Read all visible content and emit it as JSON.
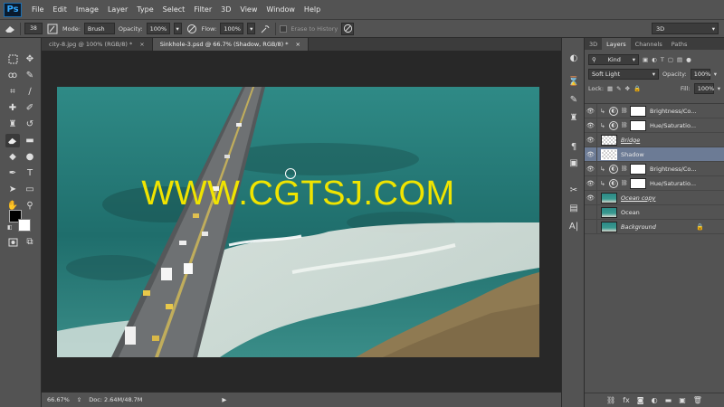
{
  "app": {
    "logo": "Ps"
  },
  "menu": [
    "File",
    "Edit",
    "Image",
    "Layer",
    "Type",
    "Select",
    "Filter",
    "3D",
    "View",
    "Window",
    "Help"
  ],
  "options": {
    "brush_size": "38",
    "mode_label": "Mode:",
    "mode_value": "Brush",
    "opacity_label": "Opacity:",
    "opacity_value": "100%",
    "flow_label": "Flow:",
    "flow_value": "100%",
    "erase_history_label": "Erase to History",
    "workspace": "3D"
  },
  "doc_tabs": [
    {
      "label": "city-8.jpg @ 100% (RGB/8) *",
      "close": "×"
    },
    {
      "label": "Sinkhole-3.psd @ 66.7% (Shadow, RGB/8) *",
      "close": "×"
    }
  ],
  "canvas": {
    "watermark": "WWW.CGTSJ.COM"
  },
  "status": {
    "zoom": "66.67%",
    "doc_size": "Doc: 2.64M/48.7M"
  },
  "panel_tabs": [
    "3D",
    "Layers",
    "Channels",
    "Paths"
  ],
  "layers_panel": {
    "filter_kind": "Kind",
    "blend_mode": "Soft Light",
    "opacity_label": "Opacity:",
    "opacity_value": "100%",
    "lock_label": "Lock:",
    "fill_label": "Fill:",
    "fill_value": "100%"
  },
  "layers": [
    {
      "name": "Brightness/Co...",
      "type": "adjustment",
      "visible": true,
      "selected": false
    },
    {
      "name": "Hue/Saturatio...",
      "type": "adjustment",
      "visible": true,
      "selected": false
    },
    {
      "name": "Bridge",
      "type": "pixel-transparent",
      "visible": true,
      "selected": false
    },
    {
      "name": "Shadow",
      "type": "pixel-transparent",
      "visible": true,
      "selected": true
    },
    {
      "name": "Brightness/Co...",
      "type": "adjustment",
      "visible": true,
      "selected": false
    },
    {
      "name": "Hue/Saturatio...",
      "type": "adjustment",
      "visible": true,
      "selected": false
    },
    {
      "name": "Ocean copy",
      "type": "pixel-ocean",
      "visible": true,
      "selected": false
    },
    {
      "name": "Ocean",
      "type": "pixel-ocean",
      "visible": false,
      "selected": false
    },
    {
      "name": "Background",
      "type": "pixel-ocean",
      "visible": false,
      "selected": false,
      "locked": true
    }
  ],
  "colors": {
    "selected_layer": "#6c7b95",
    "panel_bg": "#535353",
    "watermark": "#f0e400"
  }
}
